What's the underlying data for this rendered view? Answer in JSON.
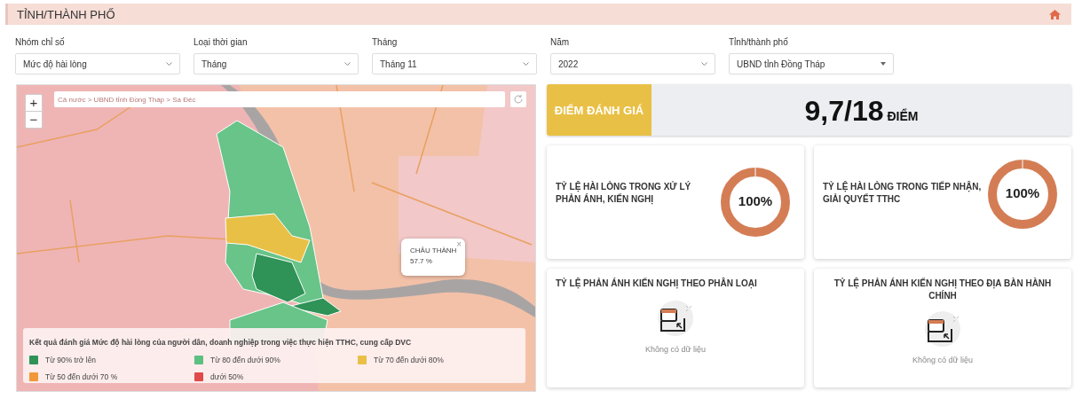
{
  "header": {
    "title": "TỈNH/THÀNH PHỐ"
  },
  "filters": [
    {
      "label": "Nhóm chỉ số",
      "value": "Mức độ hài lòng",
      "kind": "chevron"
    },
    {
      "label": "Loại thời gian",
      "value": "Tháng",
      "kind": "chevron"
    },
    {
      "label": "Tháng",
      "value": "Tháng 11",
      "kind": "chevron"
    },
    {
      "label": "Năm",
      "value": "2022",
      "kind": "chevron"
    },
    {
      "label": "Tỉnh/thành phố",
      "value": "UBND tỉnh Đồng Tháp",
      "kind": "triangle"
    }
  ],
  "map": {
    "zoom_in": "+",
    "zoom_out": "−",
    "breadcrumb": "Cả nước > UBND tỉnh Đồng Tháp > Sa Đéc",
    "popup": {
      "title": "CHÂU THÀNH",
      "value": "57.7 %",
      "close": "×"
    },
    "legend": {
      "title": "Kết quả đánh giá Mức độ hài lòng của người dân, doanh nghiệp trong việc thực hiện TTHC, cung cấp DVC",
      "items": [
        {
          "label": "Từ 90% trở lên",
          "color": "#2f9257"
        },
        {
          "label": "Từ 80 đến dưới 90%",
          "color": "#5cc080"
        },
        {
          "label": "Từ 70 đến dưới 80%",
          "color": "#e9c046"
        },
        {
          "label": "Từ 50 đến dưới 70 %",
          "color": "#f0983a"
        },
        {
          "label": "dưới 50%",
          "color": "#e04a4a"
        }
      ]
    }
  },
  "score": {
    "label": "ĐIỂM ĐÁNH GIÁ",
    "value": "9,7/18",
    "unit": "ĐIỂM"
  },
  "cards": [
    {
      "kind": "gauge",
      "title": "TỶ LỆ HÀI LÒNG TRONG XỬ LÝ PHẢN ÁNH, KIẾN NGHỊ",
      "level": 1,
      "reading": "100%"
    },
    {
      "kind": "gauge",
      "title": "TỶ LỆ HÀI LÒNG TRONG TIẾP NHẬN, GIẢI QUYẾT TTHC",
      "level": 1,
      "reading": "100%"
    },
    {
      "kind": "empty",
      "title": "TỶ LỆ PHẢN ÁNH KIẾN NGHỊ THEO PHÂN LOẠI",
      "message": "Không có dữ liệu"
    },
    {
      "kind": "empty",
      "title": "TỶ LỆ PHẢN ÁNH KIẾN NGHỊ THEO ĐỊA BÀN HÀNH CHÍNH",
      "message": "Không có dữ liệu"
    }
  ]
}
